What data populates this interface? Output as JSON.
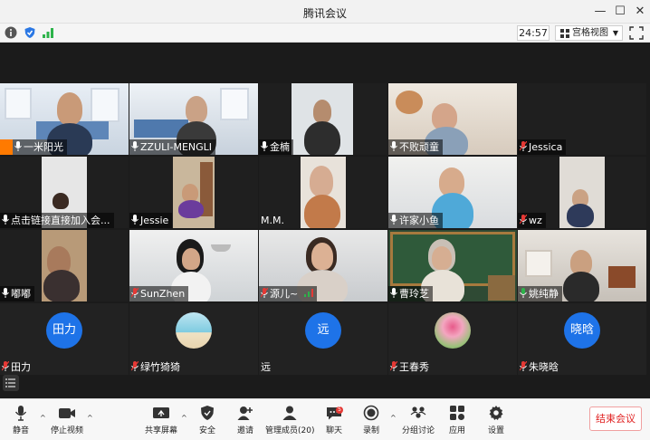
{
  "window": {
    "title": "腾讯会议"
  },
  "infobar": {
    "timer": "24:57",
    "view_label": "宫格视图"
  },
  "tiles": [
    {
      "name": "一米阳光",
      "host": true
    },
    {
      "name": "ZZULI-MENGLI"
    },
    {
      "name": "金楠"
    },
    {
      "name": "不败顽童"
    },
    {
      "name": "Jessica",
      "muted": true
    },
    {
      "name": "点击链接直接加入会..."
    },
    {
      "name": "Jessie"
    },
    {
      "name": "M.M."
    },
    {
      "name": "许家小鱼"
    },
    {
      "name": "wz",
      "muted": true
    },
    {
      "name": "嘟嘟"
    },
    {
      "name": "SunZhen",
      "muted": true
    },
    {
      "name": "源儿~",
      "muted": true
    },
    {
      "name": "曹玲芝"
    },
    {
      "name": "姚纯静"
    },
    {
      "name": "田力",
      "muted": true,
      "avatar_text": "田力"
    },
    {
      "name": "绿竹猗猗",
      "muted": true
    },
    {
      "name": "远",
      "avatar_text": "远"
    },
    {
      "name": "王春秀",
      "muted": true
    },
    {
      "name": "朱晓晗",
      "muted": true,
      "avatar_text": "晓晗"
    }
  ],
  "toolbar": {
    "mute": "静音",
    "stop_video": "停止视频",
    "share": "共享屏幕",
    "security": "安全",
    "invite": "邀请",
    "members": "管理成员(20)",
    "chat": "聊天",
    "chat_badge": "5",
    "record": "录制",
    "breakout": "分组讨论",
    "apps": "应用",
    "settings": "设置",
    "end": "结束会议"
  },
  "colors": {
    "accent": "#1e73e8",
    "end_red": "#e02020",
    "host_orange": "#ff7a00"
  }
}
